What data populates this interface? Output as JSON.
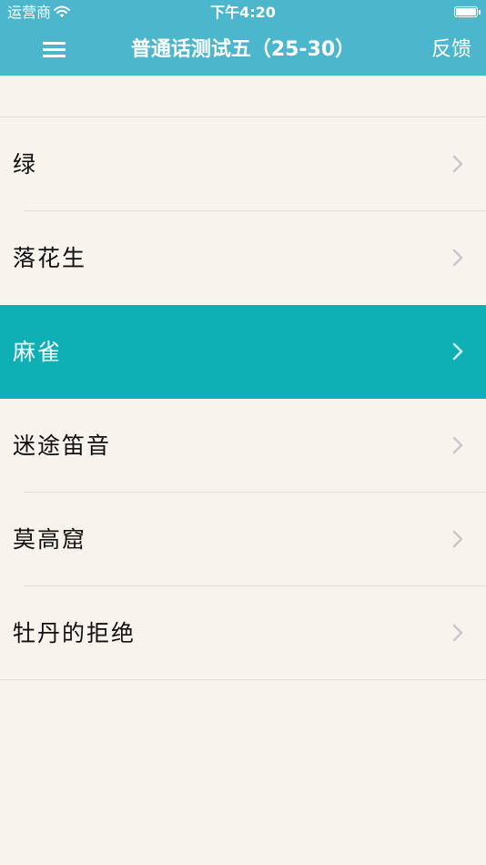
{
  "status_bar": {
    "carrier": "运营商",
    "time": "下午4:20",
    "wifi_icon": "wifi-icon",
    "battery_icon": "battery-icon",
    "battery_level": 1.0
  },
  "nav": {
    "menu_icon": "hamburger-menu-icon",
    "title": "普通话测试五（25-30）",
    "feedback": "反馈"
  },
  "list": {
    "items": [
      {
        "label": "绿",
        "selected": false
      },
      {
        "label": "落花生",
        "selected": false
      },
      {
        "label": "麻雀",
        "selected": true
      },
      {
        "label": "迷途笛音",
        "selected": false
      },
      {
        "label": "莫高窟",
        "selected": false
      },
      {
        "label": "牡丹的拒绝",
        "selected": false
      }
    ],
    "chevron_icon": "chevron-right-icon"
  },
  "colors": {
    "header": "#4bb6cc",
    "selected_row": "#0eafb5",
    "background": "#f8f4ed",
    "separator": "#e0dcd4",
    "chevron": "#c8c8cc"
  }
}
